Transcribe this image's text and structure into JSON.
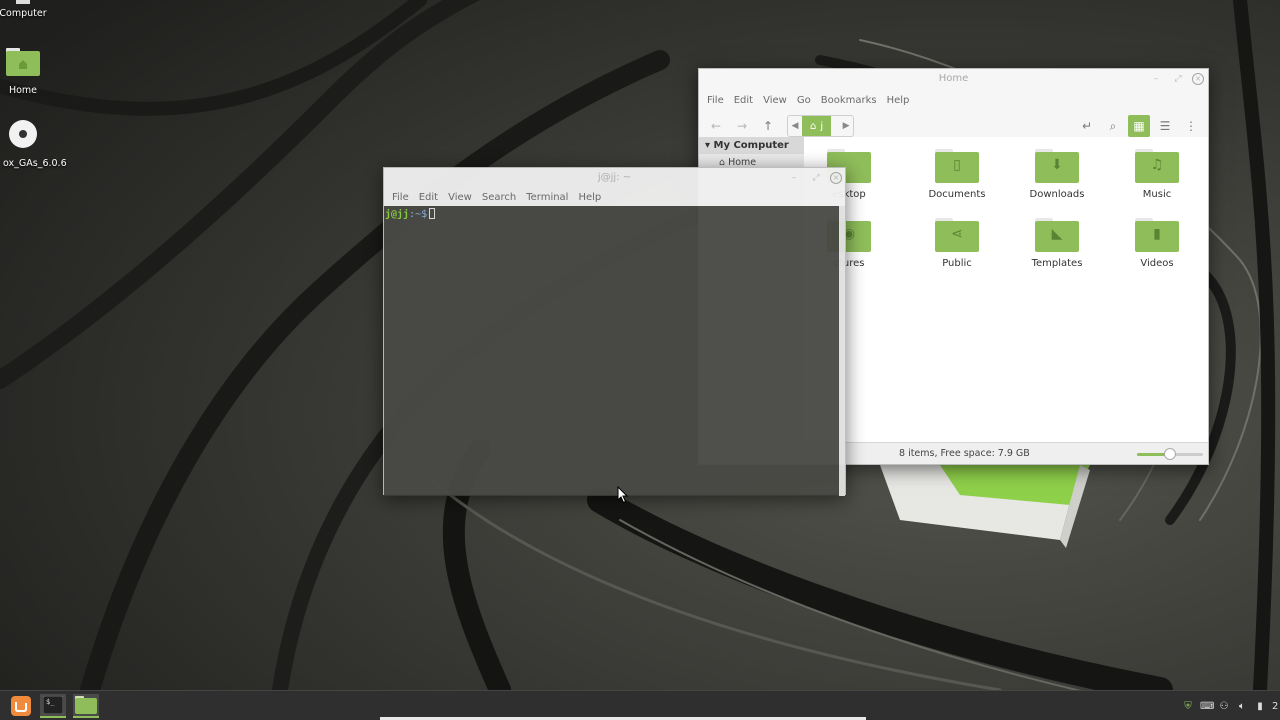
{
  "desktop": {
    "icons": [
      {
        "label": "Computer"
      },
      {
        "label": "Home"
      },
      {
        "label": "ox_GAs_6.0.6"
      }
    ]
  },
  "file_manager": {
    "title": "Home",
    "menu": [
      "File",
      "Edit",
      "View",
      "Go",
      "Bookmarks",
      "Help"
    ],
    "breadcrumb": "j",
    "sidebar": {
      "heading": "My Computer",
      "items": [
        "Home"
      ]
    },
    "folders": [
      {
        "label": "esktop",
        "icon": "desktop-folder-icon",
        "symbol": ""
      },
      {
        "label": "Documents",
        "icon": "documents-folder-icon",
        "symbol": "▯"
      },
      {
        "label": "Downloads",
        "icon": "downloads-folder-icon",
        "symbol": "⬇"
      },
      {
        "label": "Music",
        "icon": "music-folder-icon",
        "symbol": "♫"
      },
      {
        "label": "ctures",
        "icon": "pictures-folder-icon",
        "symbol": "◉"
      },
      {
        "label": "Public",
        "icon": "public-folder-icon",
        "symbol": "⋖"
      },
      {
        "label": "Templates",
        "icon": "templates-folder-icon",
        "symbol": "◣"
      },
      {
        "label": "Videos",
        "icon": "videos-folder-icon",
        "symbol": "▮"
      }
    ],
    "status": "8 items, Free space: 7.9 GB",
    "zoom_level": 0.5,
    "accent": "#8fbd5a"
  },
  "terminal": {
    "title": "j@jj: ~",
    "menu": [
      "File",
      "Edit",
      "View",
      "Search",
      "Terminal",
      "Help"
    ],
    "prompt_user": "j@jj",
    "prompt_path": ":~$"
  },
  "taskbar": {
    "clock_partial": "2"
  }
}
